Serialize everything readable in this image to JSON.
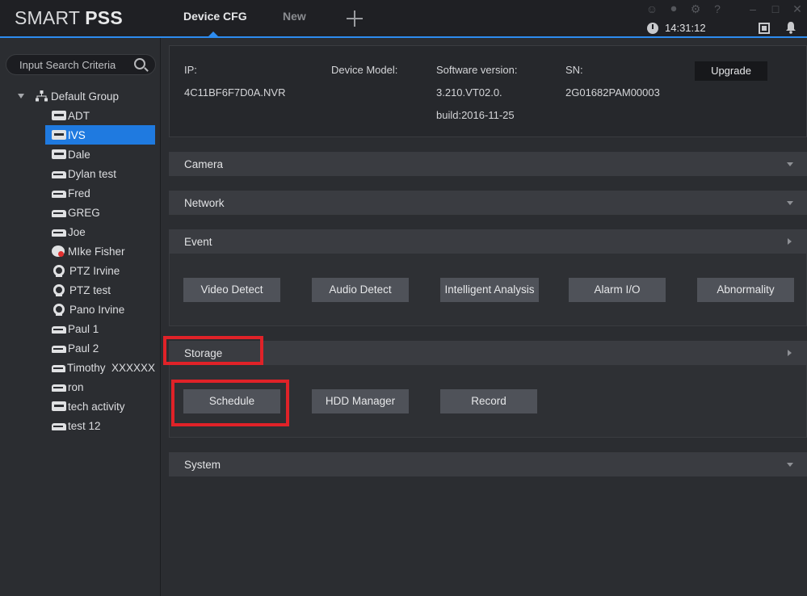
{
  "app": {
    "logo_prefix": "SMART ",
    "logo_bold": "PSS"
  },
  "tabs": {
    "active": "Device CFG",
    "new": "New"
  },
  "status": {
    "time": "14:31:12"
  },
  "sidebar": {
    "search_placeholder": "Input Search Criteria",
    "group_label": "Default Group",
    "devices": [
      {
        "label": "ADT",
        "icon": "nvr-icon"
      },
      {
        "label": "IVS",
        "icon": "nvr-icon",
        "selected": true
      },
      {
        "label": "Dale",
        "icon": "nvr-icon"
      },
      {
        "label": "Dylan test",
        "icon": "dvr-icon"
      },
      {
        "label": "Fred",
        "icon": "dvr-icon"
      },
      {
        "label": "GREG",
        "icon": "dvr-icon"
      },
      {
        "label": "Joe",
        "icon": "dvr-icon"
      },
      {
        "label": "MIke Fisher",
        "icon": "offline-device-icon"
      },
      {
        "label": "PTZ Irvine",
        "icon": "ptz-camera-icon"
      },
      {
        "label": "PTZ test",
        "icon": "ptz-camera-icon"
      },
      {
        "label": "Pano Irvine",
        "icon": "ptz-camera-icon"
      },
      {
        "label": "Paul 1",
        "icon": "dvr-icon"
      },
      {
        "label": "Paul 2",
        "icon": "dvr-icon"
      },
      {
        "label": "Timothy  XXXXXX",
        "icon": "dvr-icon"
      },
      {
        "label": "ron",
        "icon": "dvr-icon"
      },
      {
        "label": "tech activity",
        "icon": "nvr-icon"
      },
      {
        "label": "test 12",
        "icon": "dvr-icon"
      }
    ]
  },
  "device_info": {
    "ip_label": "IP:",
    "ip_value": "4C11BF6F7D0A.NVR",
    "model_label": "Device Model:",
    "sw_label": "Software version:",
    "sw_value_1": "3.210.VT02.0.",
    "sw_value_2": "build:2016-11-25",
    "sn_label": "SN:",
    "sn_value": "2G01682PAM00003",
    "upgrade_label": "Upgrade"
  },
  "sections": {
    "camera": "Camera",
    "network": "Network",
    "event": "Event",
    "storage": "Storage",
    "system": "System"
  },
  "event_buttons": [
    "Video Detect",
    "Audio Detect",
    "Intelligent Analysis",
    "Alarm I/O",
    "Abnormality"
  ],
  "storage_buttons": [
    "Schedule",
    "HDD Manager",
    "Record"
  ],
  "colors": {
    "accent": "#2d8cf0",
    "selected": "#1f7ae0",
    "highlight": "#e02228"
  }
}
